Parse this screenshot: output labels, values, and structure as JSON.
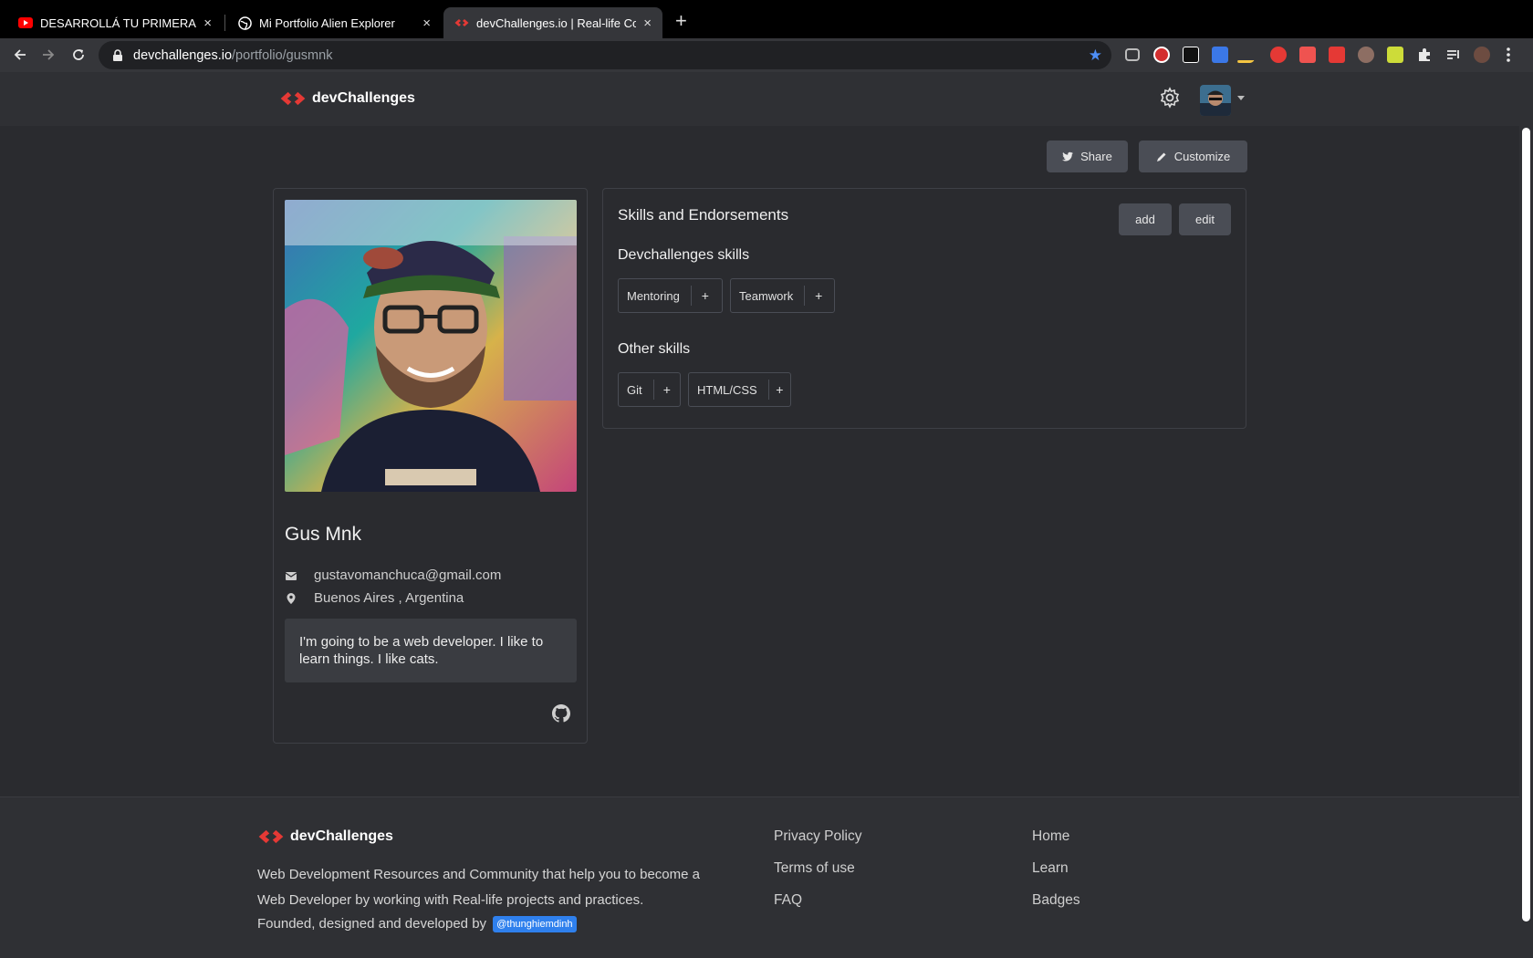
{
  "browser": {
    "tabs": [
      {
        "title": "DESARROLLÁ TU PRIMERA W",
        "icon": "youtube-icon",
        "active": false
      },
      {
        "title": "Mi Portfolio Alien Explorer",
        "icon": "globe-icon",
        "active": false
      },
      {
        "title": "devChallenges.io | Real-life Co",
        "icon": "devchallenges-icon",
        "active": true
      }
    ],
    "new_tab": "+",
    "close": "×",
    "url_host": "devchallenges.io",
    "url_path": "/portfolio/gusmnk"
  },
  "header": {
    "brand": "devChallenges"
  },
  "actions": {
    "share": "Share",
    "customize": "Customize"
  },
  "profile": {
    "name": "Gus Mnk",
    "email": "gustavomanchuca@gmail.com",
    "location": "Buenos Aires , Argentina",
    "bio": "I'm going to be a web developer. I like to learn things. I like cats."
  },
  "skills": {
    "title": "Skills and Endorsements",
    "add": "add",
    "edit": "edit",
    "dev_heading": "Devchallenges skills",
    "dev_skills": [
      "Mentoring",
      "Teamwork"
    ],
    "other_heading": "Other skills",
    "other_skills": [
      "Git",
      "HTML/CSS"
    ],
    "plus": "+"
  },
  "footer": {
    "brand": "devChallenges",
    "desc_line1": "Web Development Resources and Community that help you to become a",
    "desc_line2": "Web Developer by working with Real-life projects and practices.",
    "desc_line3": "Founded, designed and developed by",
    "handle": "@thunghiemdinh",
    "links_col1": [
      "Privacy Policy",
      "Terms of use",
      "FAQ"
    ],
    "links_col2": [
      "Home",
      "Learn",
      "Badges"
    ]
  },
  "colors": {
    "accent": "#e53935",
    "handle_bg": "#2f80ed",
    "star": "#4d8ef7"
  }
}
